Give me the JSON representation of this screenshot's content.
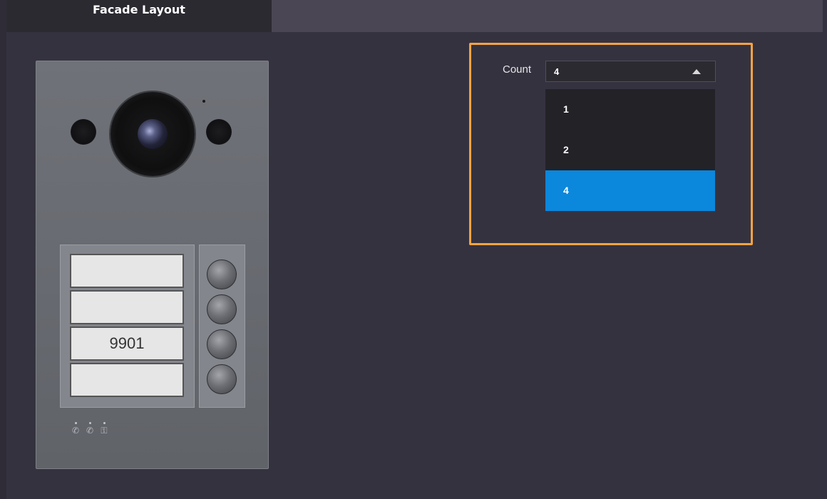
{
  "tabs": [
    {
      "label": "Facade Layout",
      "active": true
    }
  ],
  "intercom": {
    "name_labels": [
      "",
      "",
      "9901",
      ""
    ],
    "call_buttons": 4,
    "status_icons": [
      "call-incoming-icon",
      "call-connected-icon",
      "unlock-icon"
    ]
  },
  "count_setting": {
    "label": "Count",
    "selected_value": "4",
    "options": [
      "1",
      "2",
      "4"
    ],
    "dropdown_open": true
  },
  "colors": {
    "background": "#353240",
    "highlight_border": "#f6a443",
    "selected_option": "#0b87dc"
  }
}
